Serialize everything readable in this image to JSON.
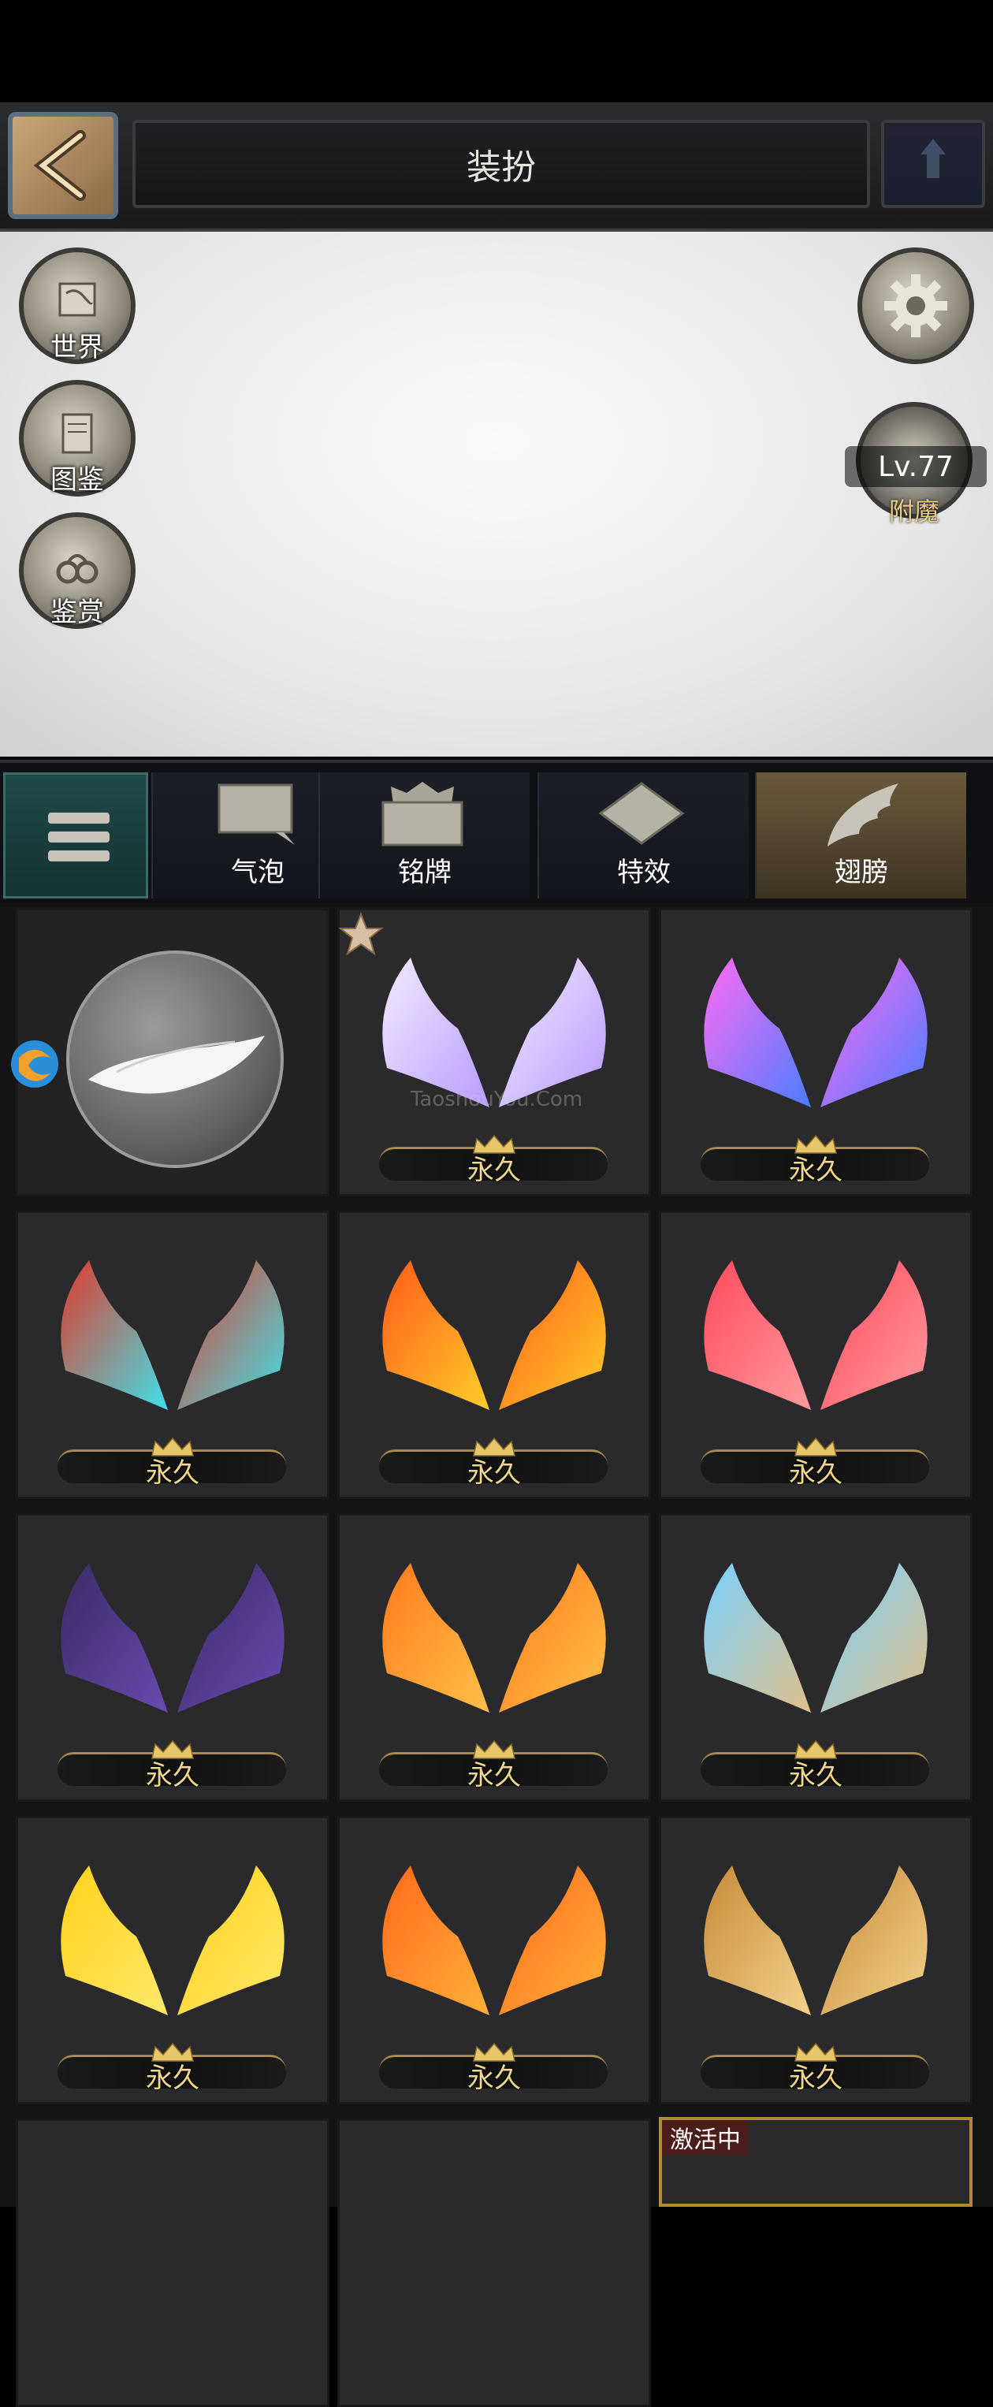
{
  "header": {
    "title": "装扮"
  },
  "left_buttons": [
    {
      "label": "世界",
      "icon": "map-scroll-icon"
    },
    {
      "label": "图鉴",
      "icon": "scroll-icon"
    },
    {
      "label": "鉴赏",
      "icon": "handcuff-icon"
    }
  ],
  "settings": {
    "icon": "gear-icon"
  },
  "level_badge": {
    "level": "Lv.77",
    "label": "附魔"
  },
  "tabs": [
    {
      "label": "气泡",
      "active": false
    },
    {
      "label": "铭牌",
      "active": false
    },
    {
      "label": "特效",
      "active": false
    },
    {
      "label": "翅膀",
      "active": true
    }
  ],
  "items": [
    {
      "label": "永久",
      "colors": [
        "#f3eaff",
        "#b89cff"
      ]
    },
    {
      "label": "永久",
      "colors": [
        "#ff6cf3",
        "#4b7cff"
      ]
    },
    {
      "label": "永久",
      "colors": [
        "#e23a2a",
        "#3fe0e8"
      ]
    },
    {
      "label": "永久",
      "colors": [
        "#ff5a1a",
        "#ffce2a"
      ]
    },
    {
      "label": "永久",
      "colors": [
        "#ff4a5a",
        "#ff9aa0"
      ]
    },
    {
      "label": "永久",
      "colors": [
        "#3a2a66",
        "#6a4ab0"
      ]
    },
    {
      "label": "永久",
      "colors": [
        "#ff7a1a",
        "#ffc04a"
      ]
    },
    {
      "label": "永久",
      "colors": [
        "#7ad0ff",
        "#e0c08a"
      ]
    },
    {
      "label": "永久",
      "colors": [
        "#ffd21a",
        "#ffe86a"
      ]
    },
    {
      "label": "永久",
      "colors": [
        "#ff6a1a",
        "#ffb03a"
      ]
    },
    {
      "label": "永久",
      "colors": [
        "#c88a3a",
        "#f2d28a"
      ]
    }
  ],
  "active_tag": "激活中",
  "watermark": "TaoshouYou.Com"
}
